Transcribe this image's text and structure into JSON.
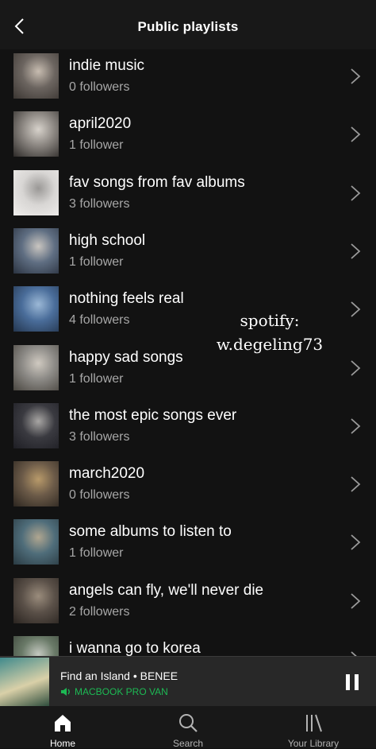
{
  "header": {
    "title": "Public playlists"
  },
  "playlists": [
    {
      "title": "indie music",
      "followers": "0 followers",
      "art": [
        "#6c6560",
        "#c7bcb0",
        "#3b3632"
      ]
    },
    {
      "title": "april2020",
      "followers": "1 follower",
      "art": [
        "#8a8580",
        "#d7d2cb",
        "#2d2a28"
      ]
    },
    {
      "title": "fav songs from fav albums",
      "followers": "3 followers",
      "art": [
        "#d8d6d4",
        "#9a9896",
        "#efedeb"
      ]
    },
    {
      "title": "high school",
      "followers": "1 follower",
      "art": [
        "#5f6e82",
        "#c9c5c0",
        "#2a3240"
      ]
    },
    {
      "title": "nothing feels real",
      "followers": "4 followers",
      "art": [
        "#4a6d9a",
        "#9bb8d6",
        "#24364f"
      ]
    },
    {
      "title": "happy sad songs",
      "followers": "1 follower",
      "art": [
        "#8c8a86",
        "#cfc9c0",
        "#4a4640"
      ]
    },
    {
      "title": "the most epic songs ever",
      "followers": "3 followers",
      "art": [
        "#3a3a40",
        "#a8a6a4",
        "#1e1e24"
      ]
    },
    {
      "title": "march2020",
      "followers": "0 followers",
      "art": [
        "#6b5a48",
        "#b89a6a",
        "#2c2620"
      ]
    },
    {
      "title": "some albums to listen to",
      "followers": "1 follower",
      "art": [
        "#4f6d7a",
        "#b0a690",
        "#2a3a42"
      ]
    },
    {
      "title": "angels can fly, we'll never die",
      "followers": "2 followers",
      "art": [
        "#5a5048",
        "#9a8c7c",
        "#2a2420"
      ]
    },
    {
      "title": "i wanna go to korea",
      "followers": "",
      "art": [
        "#6a7a68",
        "#c4c8c0",
        "#3a4238"
      ]
    }
  ],
  "watermark": {
    "line1": "spotify:",
    "line2": "w.degeling73"
  },
  "now_playing": {
    "track": "Find an Island • BENEE",
    "device": "MACBOOK PRO VAN",
    "art": [
      "#3f8a8c",
      "#d9d0a8",
      "#2a4a3a"
    ]
  },
  "tabs": [
    {
      "label": "Home",
      "icon": "home-icon",
      "active": true
    },
    {
      "label": "Search",
      "icon": "search-icon",
      "active": false
    },
    {
      "label": "Your Library",
      "icon": "library-icon",
      "active": false
    }
  ],
  "colors": {
    "background": "#121212",
    "accent": "#1db954",
    "secondary_text": "#a7a7a7"
  }
}
